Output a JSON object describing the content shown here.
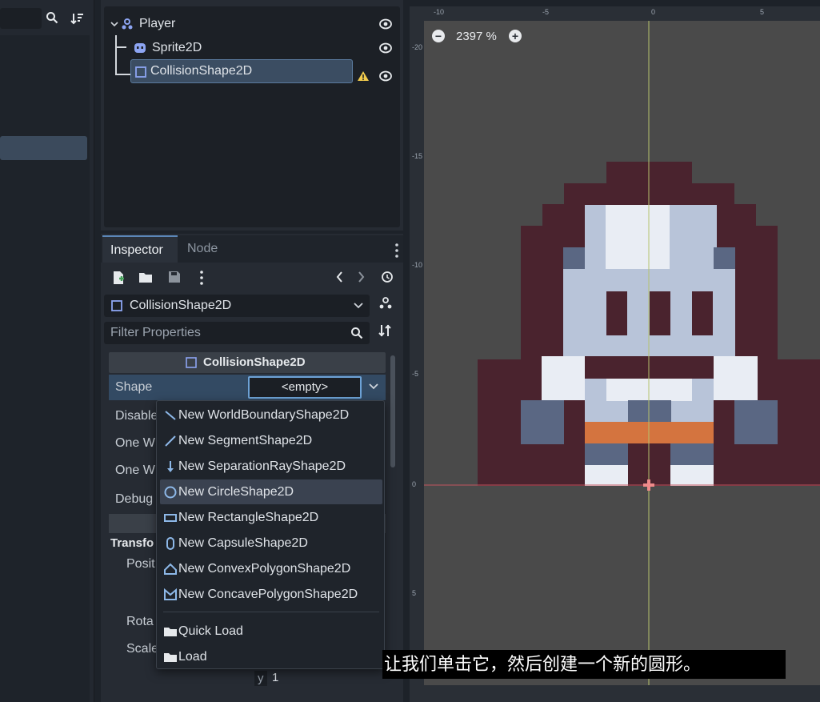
{
  "colors": {
    "accent": "#5c87b8",
    "selection": "#3b4d62",
    "warning": "#f2cc4d",
    "canvas_bg": "#4a4a4a",
    "subtitle_bg": "#000000"
  },
  "scene_tree": {
    "nodes": [
      {
        "label": "Player",
        "icon": "node2d-icon"
      },
      {
        "label": "Sprite2D",
        "icon": "sprite2d-icon"
      },
      {
        "label": "CollisionShape2D",
        "icon": "collisionshape2d-icon",
        "selected": true,
        "warning": true
      }
    ]
  },
  "inspector": {
    "tabs": [
      "Inspector",
      "Node"
    ],
    "selected_node": "CollisionShape2D",
    "filter_placeholder": "Filter Properties",
    "section_title": "CollisionShape2D",
    "properties": [
      {
        "name": "Shape",
        "value": "<empty>"
      },
      {
        "name": "Disable"
      },
      {
        "name": "One W"
      },
      {
        "name": "One W"
      },
      {
        "name": "Debug"
      }
    ],
    "transform_section": "Transfo",
    "transform_props": [
      "Posit",
      "Rota",
      "Scale"
    ],
    "scale_y_axis": "y",
    "scale_y_value": "1"
  },
  "shape_menu": {
    "items": [
      {
        "label": "New WorldBoundaryShape2D",
        "icon": "world-boundary-icon"
      },
      {
        "label": "New SegmentShape2D",
        "icon": "segment-icon"
      },
      {
        "label": "New SeparationRayShape2D",
        "icon": "separation-ray-icon"
      },
      {
        "label": "New CircleShape2D",
        "icon": "circle-icon",
        "hover": true
      },
      {
        "label": "New RectangleShape2D",
        "icon": "rectangle-icon"
      },
      {
        "label": "New CapsuleShape2D",
        "icon": "capsule-icon"
      },
      {
        "label": "New ConvexPolygonShape2D",
        "icon": "convex-polygon-icon"
      },
      {
        "label": "New ConcavePolygonShape2D",
        "icon": "concave-polygon-icon"
      }
    ],
    "load_items": [
      {
        "label": "Quick Load",
        "icon": "folder-icon"
      },
      {
        "label": "Load",
        "icon": "folder-icon"
      }
    ]
  },
  "viewport": {
    "zoom": "2397 %",
    "ruler_top": [
      "-10",
      "-5",
      "0",
      "5"
    ],
    "ruler_left": [
      "-20",
      "-15",
      "-10",
      "-5",
      "0",
      "5"
    ]
  },
  "subtitle": "让我们单击它，然后创建一个新的圆形。"
}
